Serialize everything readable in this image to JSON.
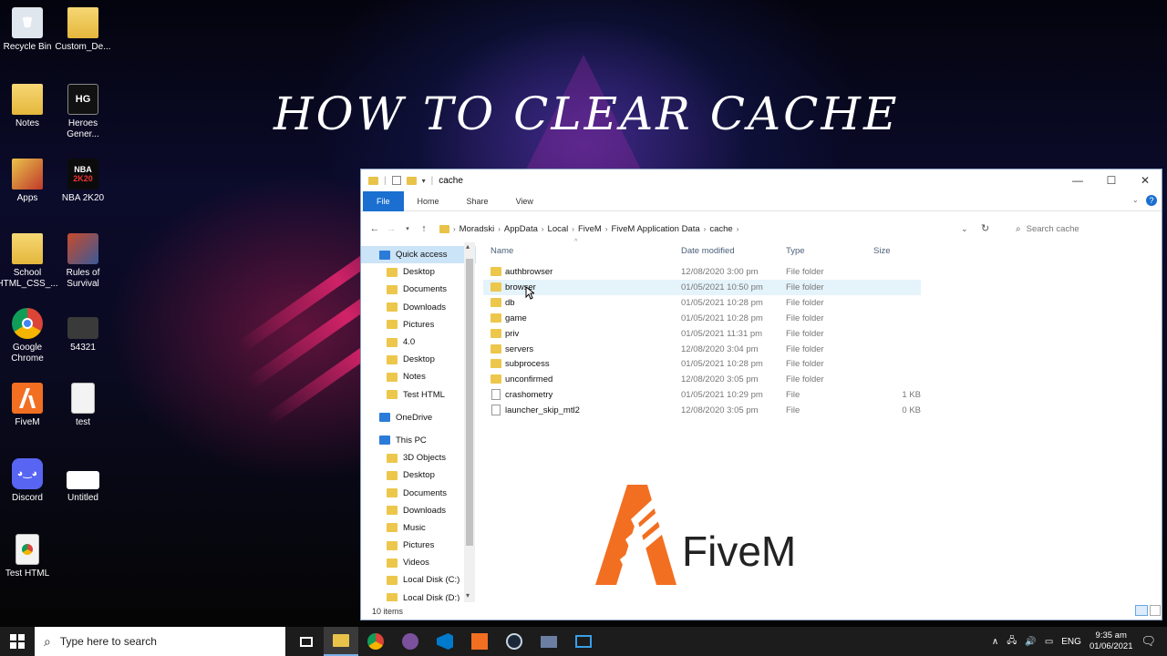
{
  "headline": "HOW TO CLEAR CACHE",
  "desktop_icons": [
    {
      "label": "Recycle Bin",
      "icon": "recycle-bin-icon"
    },
    {
      "label": "Custom_De...",
      "icon": "folder-icon"
    },
    {
      "label": "Notes",
      "icon": "folder-icon"
    },
    {
      "label": "Heroes Gener...",
      "icon": "game-icon"
    },
    {
      "label": "Apps",
      "icon": "folder-icon"
    },
    {
      "label": "NBA 2K20",
      "icon": "game-icon"
    },
    {
      "label": "School HTML_CSS_...",
      "icon": "folder-icon"
    },
    {
      "label": "Rules of Survival",
      "icon": "game-icon"
    },
    {
      "label": "Google Chrome",
      "icon": "chrome-icon"
    },
    {
      "label": "54321",
      "icon": "image-icon"
    },
    {
      "label": "FiveM",
      "icon": "fivem-icon"
    },
    {
      "label": "test",
      "icon": "document-icon"
    },
    {
      "label": "Discord",
      "icon": "discord-icon"
    },
    {
      "label": "Untitled",
      "icon": "image-icon"
    },
    {
      "label": "Test HTML",
      "icon": "chrome-document-icon"
    }
  ],
  "nba_badge": "NBA",
  "nba_year": "2K20",
  "explorer": {
    "title": "cache",
    "ribbon_tabs": [
      "File",
      "Home",
      "Share",
      "View"
    ],
    "breadcrumb": [
      "Moradski",
      "AppData",
      "Local",
      "FiveM",
      "FiveM Application Data",
      "cache"
    ],
    "search_placeholder": "Search cache",
    "nav": [
      {
        "label": "Quick access",
        "kind": "header",
        "selected": true
      },
      {
        "label": "Desktop",
        "pinned": true
      },
      {
        "label": "Documents",
        "pinned": true
      },
      {
        "label": "Downloads",
        "pinned": true
      },
      {
        "label": "Pictures",
        "pinned": true
      },
      {
        "label": "4.0"
      },
      {
        "label": "Desktop"
      },
      {
        "label": "Notes"
      },
      {
        "label": "Test HTML"
      },
      {
        "label": "OneDrive",
        "kind": "header"
      },
      {
        "label": "This PC",
        "kind": "header"
      },
      {
        "label": "3D Objects"
      },
      {
        "label": "Desktop"
      },
      {
        "label": "Documents"
      },
      {
        "label": "Downloads"
      },
      {
        "label": "Music"
      },
      {
        "label": "Pictures"
      },
      {
        "label": "Videos"
      },
      {
        "label": "Local Disk (C:)"
      },
      {
        "label": "Local Disk (D:)"
      }
    ],
    "columns": {
      "name": "Name",
      "date": "Date modified",
      "type": "Type",
      "size": "Size"
    },
    "files": [
      {
        "name": "authbrowser",
        "date": "12/08/2020 3:00 pm",
        "type": "File folder",
        "size": "",
        "kind": "folder"
      },
      {
        "name": "browser",
        "date": "01/05/2021 10:50 pm",
        "type": "File folder",
        "size": "",
        "kind": "folder"
      },
      {
        "name": "db",
        "date": "01/05/2021 10:28 pm",
        "type": "File folder",
        "size": "",
        "kind": "folder"
      },
      {
        "name": "game",
        "date": "01/05/2021 10:28 pm",
        "type": "File folder",
        "size": "",
        "kind": "folder"
      },
      {
        "name": "priv",
        "date": "01/05/2021 11:31 pm",
        "type": "File folder",
        "size": "",
        "kind": "folder"
      },
      {
        "name": "servers",
        "date": "12/08/2020 3:04 pm",
        "type": "File folder",
        "size": "",
        "kind": "folder"
      },
      {
        "name": "subprocess",
        "date": "01/05/2021 10:28 pm",
        "type": "File folder",
        "size": "",
        "kind": "folder"
      },
      {
        "name": "unconfirmed",
        "date": "12/08/2020 3:05 pm",
        "type": "File folder",
        "size": "",
        "kind": "folder"
      },
      {
        "name": "crashometry",
        "date": "01/05/2021 10:29 pm",
        "type": "File",
        "size": "1 KB",
        "kind": "file"
      },
      {
        "name": "launcher_skip_mtl2",
        "date": "12/08/2020 3:05 pm",
        "type": "File",
        "size": "0 KB",
        "kind": "file"
      }
    ],
    "status": "10 items"
  },
  "overlay_logo": "FiveM",
  "taskbar": {
    "search_placeholder": "Type here to search",
    "lang": "ENG",
    "time": "9:35 am",
    "date": "01/06/2021"
  }
}
